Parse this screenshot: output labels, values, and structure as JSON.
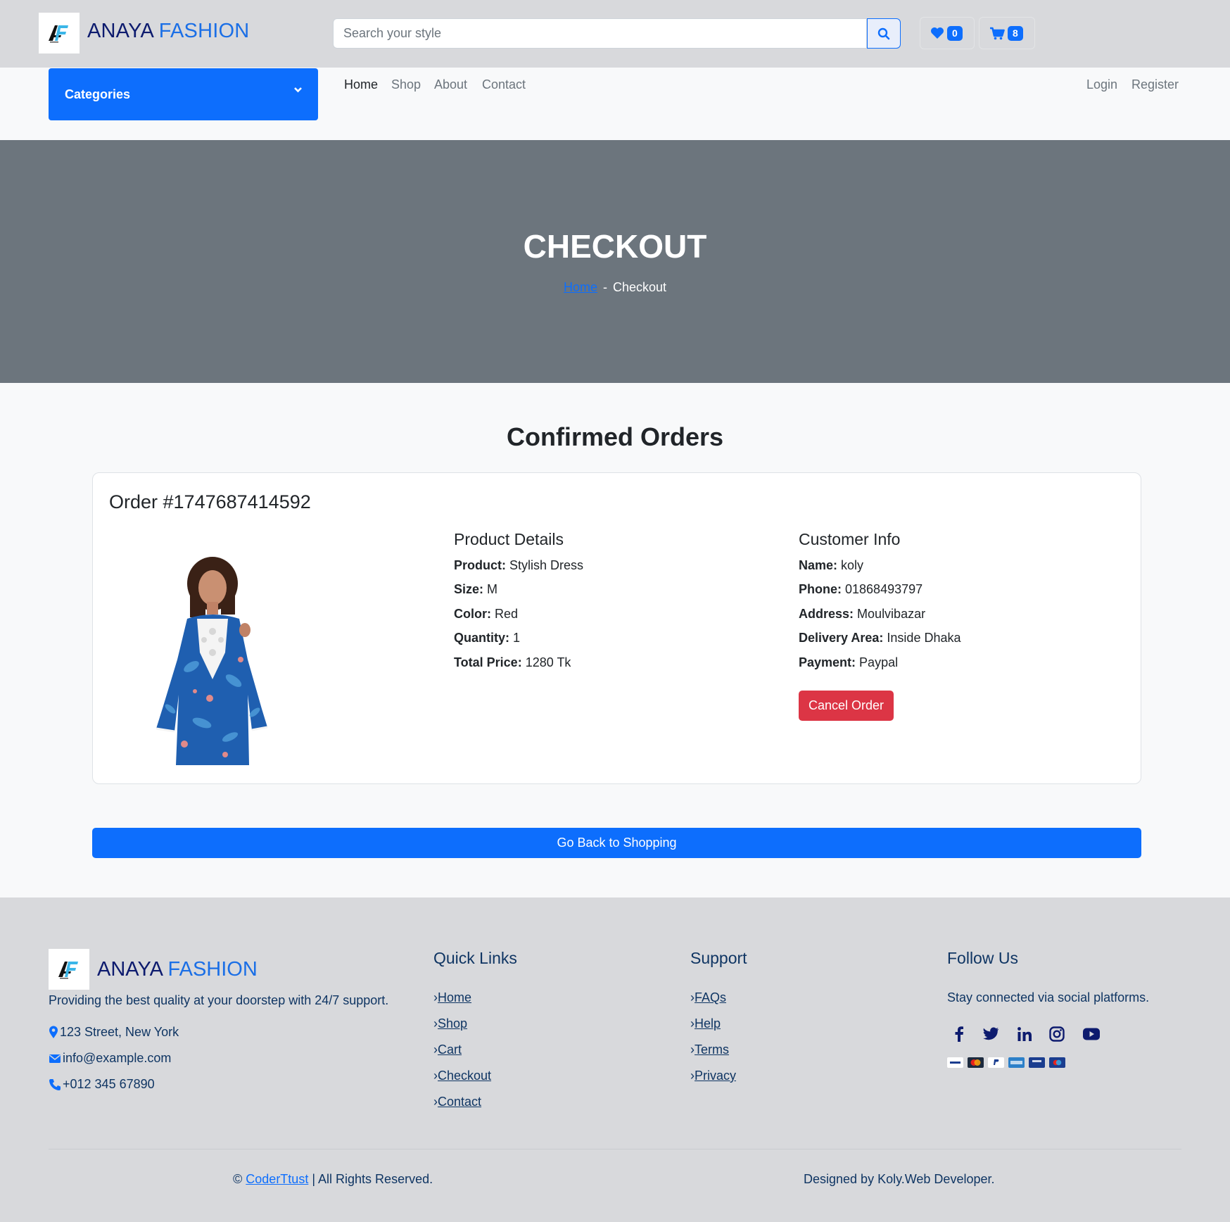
{
  "header": {
    "brand_part1": "ANAYA",
    "brand_part2": "FASHION",
    "search_placeholder": "Search your style",
    "wishlist_count": "0",
    "cart_count": "8"
  },
  "nav": {
    "categories_label": "Categories",
    "links": [
      "Home",
      "Shop",
      "About",
      "Contact"
    ],
    "login": "Login",
    "register": "Register"
  },
  "hero": {
    "title": "CHECKOUT",
    "breadcrumb_home": "Home",
    "breadcrumb_sep": "-",
    "breadcrumb_current": "Checkout"
  },
  "orders": {
    "section_title": "Confirmed Orders",
    "order_title": "Order #1747687414592",
    "product_details_title": "Product Details",
    "product": {
      "product_label": "Product:",
      "product_value": "Stylish Dress",
      "size_label": "Size:",
      "size_value": "M",
      "color_label": "Color:",
      "color_value": "Red",
      "quantity_label": "Quantity:",
      "quantity_value": "1",
      "total_label": "Total Price:",
      "total_value": "1280 Tk"
    },
    "customer_info_title": "Customer Info",
    "customer": {
      "name_label": "Name:",
      "name_value": "koly",
      "phone_label": "Phone:",
      "phone_value": "01868493797",
      "address_label": "Address:",
      "address_value": "Moulvibazar",
      "area_label": "Delivery Area:",
      "area_value": "Inside Dhaka",
      "payment_label": "Payment:",
      "payment_value": "Paypal"
    },
    "cancel_label": "Cancel Order",
    "back_label": "Go Back to Shopping"
  },
  "footer": {
    "brand_part1": "ANAYA",
    "brand_part2": "FASHION",
    "tagline": "Providing the best quality at your doorstep with 24/7 support.",
    "address": "123 Street, New York",
    "email": "info@example.com",
    "phone": "+012 345 67890",
    "quick_links_title": "Quick Links",
    "quick_links": [
      "Home",
      "Shop",
      "Cart",
      "Checkout",
      "Contact"
    ],
    "support_title": "Support",
    "support_links": [
      "FAQs",
      "Help",
      "Terms",
      "Privacy"
    ],
    "follow_title": "Follow Us",
    "follow_text": "Stay connected via social platforms.",
    "social_icons": [
      "facebook-icon",
      "twitter-icon",
      "linkedin-icon",
      "instagram-icon",
      "youtube-icon"
    ],
    "payment_icons": [
      "visa-icon",
      "mastercard-icon",
      "paypal-icon",
      "amex-icon",
      "visa-electron-icon",
      "maestro-icon"
    ],
    "copyright_prefix": "©",
    "copyright_link": "CoderTtust",
    "copyright_suffix": "| All Rights Reserved.",
    "designed_by": "Designed by Koly.Web Developer."
  },
  "colors": {
    "primary": "#0d6efd",
    "danger": "#dc3545",
    "hero_bg": "#6c757d",
    "header_bg": "#d8d9dc",
    "brand_dark": "#0d1b6e",
    "footer_text": "#0f3563"
  }
}
